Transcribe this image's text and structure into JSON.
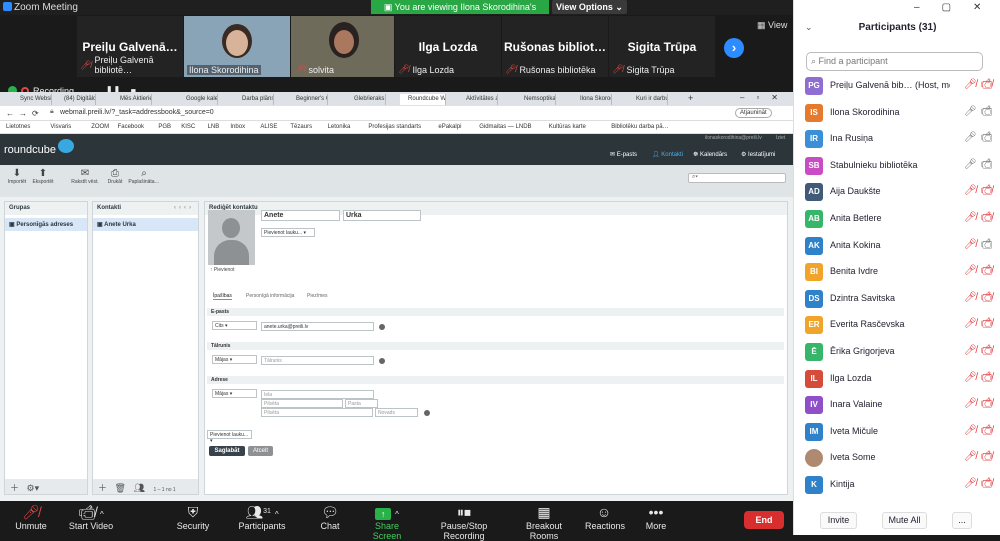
{
  "zoom": {
    "window_title": "Zoom Meeting",
    "view_banner": "You are viewing Ilona Skorodihina's screen",
    "view_options": "View Options",
    "view_label": "View",
    "recording_label": "Recording...",
    "gallery": [
      {
        "big": "Preiļu Galvenā…",
        "caption": "Preiļu Galvenā bibliotē…",
        "video": false
      },
      {
        "big": "",
        "caption": "Ilona Skorodihina",
        "video": true
      },
      {
        "big": "",
        "caption": "solvita",
        "video": true
      },
      {
        "big": "Ilga Lozda",
        "caption": "Ilga Lozda",
        "video": false
      },
      {
        "big": "Rušonas bibliot…",
        "caption": "Rušonas bibliotēka",
        "video": false
      },
      {
        "big": "Sigita Trūpa",
        "caption": "Sigita Trūpa",
        "video": false
      }
    ],
    "toolbar": {
      "unmute": "Unmute",
      "start_video": "Start Video",
      "security": "Security",
      "participants": "Participants",
      "participants_count": "31",
      "chat": "Chat",
      "share_screen": "Share Screen",
      "pause_recording": "Pause/Stop Recording",
      "breakout": "Breakout Rooms",
      "reactions": "Reactions",
      "more": "More",
      "end": "End"
    }
  },
  "browser": {
    "tabs": [
      "Sync Website",
      "(84) Digitālo ro…",
      "Mēs Aktierietis",
      "Google kalend…",
      "Darba plāns",
      "Beginner's G…",
      "Gleb/ieraks",
      "Roundcube We…",
      "Aktīvitātes ar…",
      "Nemsoptika …",
      "Ilona Skorod…",
      "Kuri ir darbu…"
    ],
    "url": "webmail.preili.lv/?_task=addressbook&_source=0",
    "update_btn": "Atjaunināt",
    "bookmarks": [
      "Lietotnes",
      "Visvaris",
      "ZOOM",
      "Facebook",
      "PGB",
      "KISC",
      "LNB",
      "Inbox",
      "ALISE",
      "Tēzaurs",
      "Letonika",
      "Profesijas standarts",
      "ePakalpi",
      "Gidmaitas — LNDB",
      "Kultūras karte",
      "Bibliotēku darba pā…"
    ]
  },
  "roundcube": {
    "logo": "roundcube",
    "user_email": "ilonaskorodihina@preili.lv",
    "logout": "Iziet",
    "nav": {
      "mail": "E-pasts",
      "contacts": "Kontakti",
      "calendar": "Kalendārs",
      "settings": "Iestatījumi"
    },
    "toolbar": {
      "import": "Importēt",
      "export": "Eksportēt",
      "create": "Rakstīt vēst.",
      "print": "Drukāt",
      "search": "Paplašināta…"
    },
    "groups_header": "Grupas",
    "groups_item": "Personīgās adreses",
    "contacts_header": "Kontakti",
    "contacts_item": "Anete Urka",
    "contacts_pager": "1 – 1 no 1",
    "edit_header": "Rediģēt kontaktu",
    "first_name": "Anete",
    "last_name": "Urka",
    "add_field": "Pievienot lauku...",
    "upload_photo": "Pievienot",
    "tabs": [
      "Īpašības",
      "Personīgā informācija",
      "Piezīmes"
    ],
    "email_section": "E-pasts",
    "email_type": "Cits",
    "email_value": "anete.urka@preili.lv",
    "phone_section": "Tālrunis",
    "phone_type": "Mājas",
    "phone_placeholder": "Tālrunis",
    "address_section": "Adrese",
    "address_type": "Mājas",
    "address_street": "Iela",
    "address_city": "Pilsēta",
    "address_postcode": "Pasta indekss",
    "address_region": "Pilsēta",
    "address_country": "Novads",
    "add_field_bottom": "Pievienot lauku...",
    "save": "Saglabāt",
    "cancel": "Atcelt"
  },
  "participants": {
    "title": "Participants (31)",
    "search_placeholder": "Find a participant",
    "list": [
      {
        "initials": "PG",
        "name": "Preiļu Galvenā bib… (Host, me)",
        "color": "#8e6fd1",
        "muted": true,
        "video_off": true
      },
      {
        "initials": "IS",
        "name": "Ilona Skorodihina",
        "color": "#e57a2f",
        "muted": false,
        "video_off": false
      },
      {
        "initials": "IR",
        "name": "Ina Rusiņa",
        "color": "#3a8fd6",
        "muted": false,
        "video_off": false
      },
      {
        "initials": "SB",
        "name": "Stabulnieku bibliotēka",
        "color": "#c94cc4",
        "muted": false,
        "video_off": false
      },
      {
        "initials": "AD",
        "name": "Aija Daukšte",
        "color": "#405a77",
        "muted": true,
        "video_off": true
      },
      {
        "initials": "AB",
        "name": "Anita Betlere",
        "color": "#37b56a",
        "muted": true,
        "video_off": true
      },
      {
        "initials": "AK",
        "name": "Anita Kokina",
        "color": "#2f82c9",
        "muted": true,
        "video_off": false
      },
      {
        "initials": "BI",
        "name": "Benita Ivdre",
        "color": "#f0a42a",
        "muted": true,
        "video_off": true
      },
      {
        "initials": "DS",
        "name": "Dzintra Savitska",
        "color": "#2f82c9",
        "muted": true,
        "video_off": true
      },
      {
        "initials": "ER",
        "name": "Everita Rasčevska",
        "color": "#f0a42a",
        "muted": true,
        "video_off": true
      },
      {
        "initials": "Ē",
        "name": "Ērika Grigorjeva",
        "color": "#37b56a",
        "muted": true,
        "video_off": true
      },
      {
        "initials": "IL",
        "name": "Ilga Lozda",
        "color": "#d64c3a",
        "muted": true,
        "video_off": true
      },
      {
        "initials": "IV",
        "name": "Inara Valaine",
        "color": "#8e4fc9",
        "muted": true,
        "video_off": true
      },
      {
        "initials": "IM",
        "name": "Iveta Mičule",
        "color": "#2f82c9",
        "muted": true,
        "video_off": true
      },
      {
        "initials": "",
        "name": "Iveta Some",
        "color": "#b08a70",
        "muted": true,
        "video_off": true
      },
      {
        "initials": "K",
        "name": "Kintija",
        "color": "#2f82c9",
        "muted": true,
        "video_off": true
      }
    ],
    "invite": "Invite",
    "mute_all": "Mute All",
    "more": "..."
  }
}
